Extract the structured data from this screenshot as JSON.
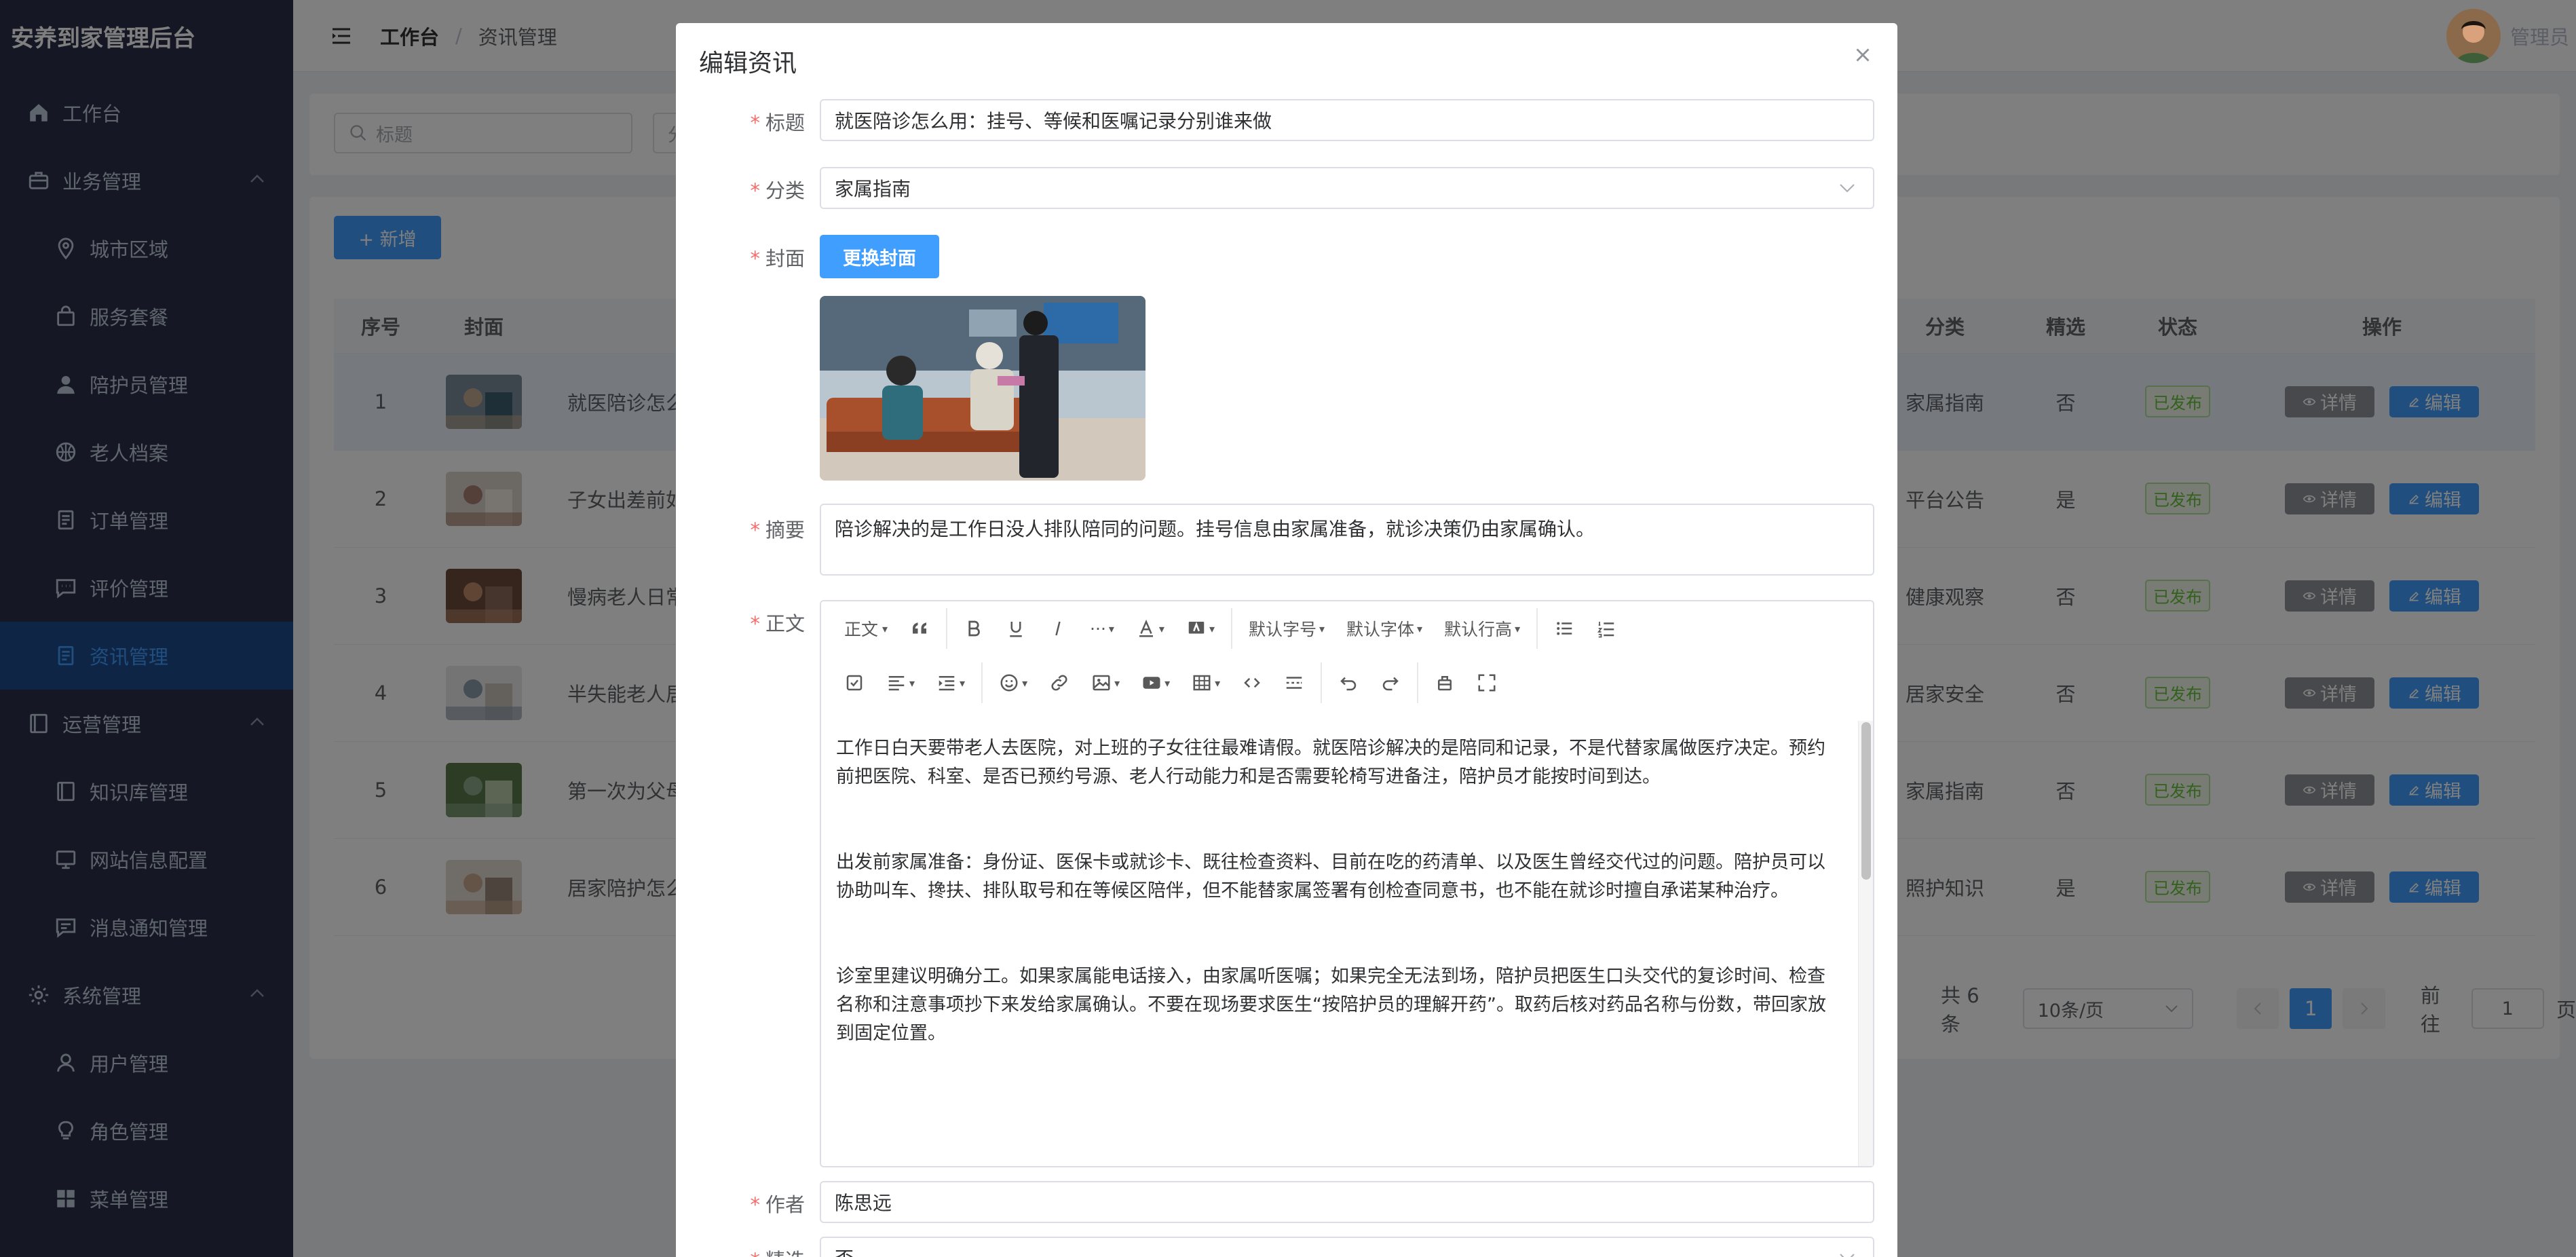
{
  "app": {
    "title": "安养到家管理后台"
  },
  "sidebar": {
    "items": [
      {
        "label": "工作台",
        "type": "group"
      },
      {
        "label": "业务管理",
        "type": "group",
        "expanded": true
      },
      {
        "label": "城市区域",
        "type": "sub"
      },
      {
        "label": "服务套餐",
        "type": "sub"
      },
      {
        "label": "陪护员管理",
        "type": "sub"
      },
      {
        "label": "老人档案",
        "type": "sub"
      },
      {
        "label": "订单管理",
        "type": "sub"
      },
      {
        "label": "评价管理",
        "type": "sub"
      },
      {
        "label": "资讯管理",
        "type": "sub",
        "active": true
      },
      {
        "label": "运营管理",
        "type": "group",
        "expanded": true
      },
      {
        "label": "知识库管理",
        "type": "sub"
      },
      {
        "label": "网站信息配置",
        "type": "sub"
      },
      {
        "label": "消息通知管理",
        "type": "sub"
      },
      {
        "label": "系统管理",
        "type": "group",
        "expanded": true
      },
      {
        "label": "用户管理",
        "type": "sub"
      },
      {
        "label": "角色管理",
        "type": "sub"
      },
      {
        "label": "菜单管理",
        "type": "sub"
      }
    ]
  },
  "navbar": {
    "breadcrumb_home": "工作台",
    "breadcrumb_sep": "/",
    "breadcrumb_current": "资讯管理",
    "user_name": "管理员"
  },
  "search": {
    "title_placeholder": "标题",
    "second_placeholder": "分"
  },
  "toolbar": {
    "add_label": "+ 新增"
  },
  "table": {
    "columns": {
      "index": "序号",
      "cover": "封面",
      "category": "分类",
      "featured": "精选",
      "status": "状态",
      "actions": "操作"
    },
    "detail_label": "详情",
    "edit_label": "编辑",
    "rows": [
      {
        "index": "1",
        "title": "就医陪诊怎么",
        "category": "家属指南",
        "featured": "否",
        "status": "已发布"
      },
      {
        "index": "2",
        "title": "子女出差前如",
        "category": "平台公告",
        "featured": "是",
        "status": "已发布"
      },
      {
        "index": "3",
        "title": "慢病老人日常",
        "category": "健康观察",
        "featured": "否",
        "status": "已发布"
      },
      {
        "index": "4",
        "title": "半失能老人居",
        "category": "居家安全",
        "featured": "否",
        "status": "已发布"
      },
      {
        "index": "5",
        "title": "第一次为父母",
        "category": "家属指南",
        "featured": "否",
        "status": "已发布"
      },
      {
        "index": "6",
        "title": "居家陪护怎么",
        "category": "照护知识",
        "featured": "是",
        "status": "已发布"
      }
    ]
  },
  "pagination": {
    "total": "共 6 条",
    "page_size": "10条/页",
    "current_page": "1",
    "goto_label": "前往",
    "goto_value": "1",
    "page_suffix": "页"
  },
  "dialog": {
    "title": "编辑资讯",
    "fields": {
      "title_label": "标题",
      "title_value": "就医陪诊怎么用：挂号、等候和医嘱记录分别谁来做",
      "category_label": "分类",
      "category_value": "家属指南",
      "cover_label": "封面",
      "cover_button": "更换封面",
      "summary_label": "摘要",
      "summary_value": "陪诊解决的是工作日没人排队陪同的问题。挂号信息由家属准备，就诊决策仍由家属确认。",
      "body_label": "正文",
      "author_label": "作者",
      "author_value": "陈思远",
      "featured_label": "精选",
      "featured_value": "否"
    },
    "editor": {
      "toolbar": {
        "paragraph": "正文",
        "font_size": "默认字号",
        "font_family": "默认字体",
        "line_height": "默认行高",
        "more": "···"
      },
      "paragraphs": [
        "工作日白天要带老人去医院，对上班的子女往往最难请假。就医陪诊解决的是陪同和记录，不是代替家属做医疗决定。预约前把医院、科室、是否已预约号源、老人行动能力和是否需要轮椅写进备注，陪护员才能按时间到达。",
        "出发前家属准备：身份证、医保卡或就诊卡、既往检查资料、目前在吃的药清单、以及医生曾经交代过的问题。陪护员可以协助叫车、搀扶、排队取号和在等候区陪伴，但不能替家属签署有创检查同意书，也不能在就诊时擅自承诺某种治疗。",
        "诊室里建议明确分工。如果家属能电话接入，由家属听医嘱；如果完全无法到场，陪护员把医生口头交代的复诊时间、检查名称和注意事项抄下来发给家属确认。不要在现场要求医生“按陪护员的理解开药”。取药后核对药品名称与份数，带回家放到固定位置。"
      ]
    }
  }
}
